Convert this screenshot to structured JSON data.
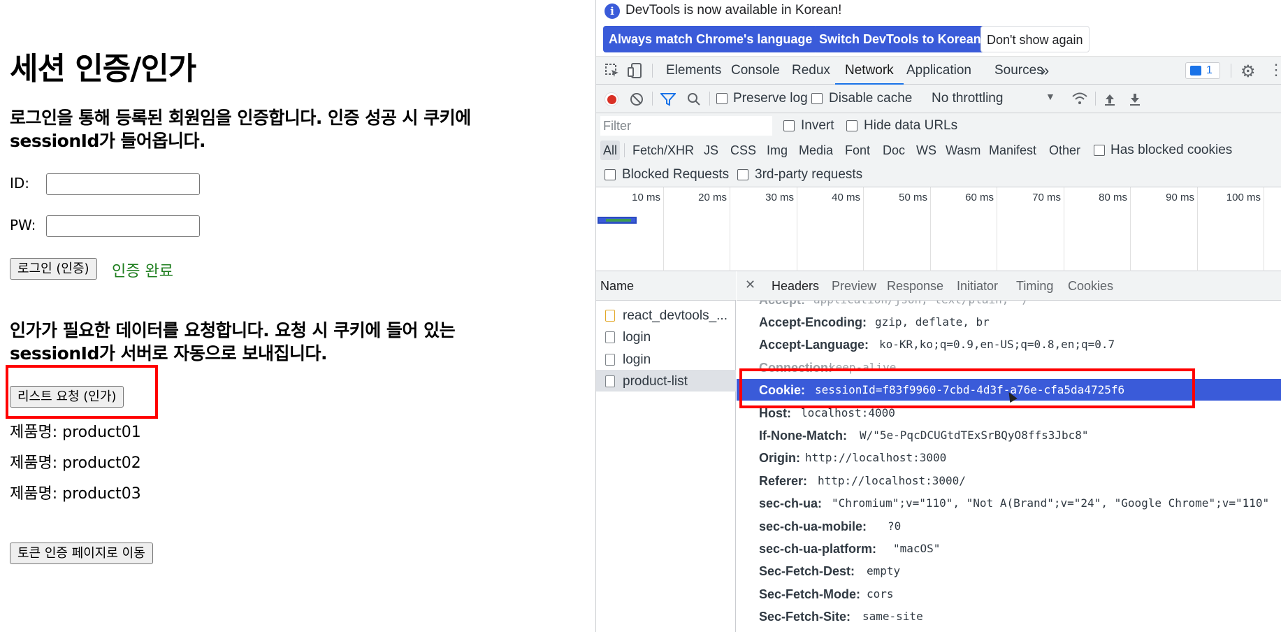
{
  "page": {
    "title": "세션 인증/인가",
    "login_desc_1": "로그인을 통해 등록된 회원임을 인증합니다. 인증 성공 시 쿠키에",
    "login_desc_2": "sessionId가 들어옵니다.",
    "id_label": "ID:",
    "pw_label": "PW:",
    "id_value": "",
    "pw_value": "",
    "login_button": "로그인 (인증)",
    "auth_status": "인증 완료",
    "authz_desc_1": "인가가 필요한 데이터를 요청합니다. 요청 시 쿠키에 들어 있는",
    "authz_desc_2": "sessionId가 서버로 자동으로 보내집니다.",
    "list_button": "리스트 요청 (인가)",
    "products": [
      "제품명: product01",
      "제품명: product02",
      "제품명: product03"
    ],
    "token_button": "토큰 인증 페이지로 이동"
  },
  "devtools": {
    "infobar": {
      "message": "DevTools is now available in Korean!",
      "btn_match": "Always match Chrome's language",
      "btn_switch": "Switch DevTools to Korean",
      "btn_dismiss": "Don't show again"
    },
    "tabs": [
      "Elements",
      "Console",
      "Redux",
      "Network",
      "Application",
      "Sources"
    ],
    "active_tab": "Network",
    "more_tabs": "»",
    "issues_count": "1",
    "toolbar": {
      "preserve_log": "Preserve log",
      "disable_cache": "Disable cache",
      "throttling": "No throttling"
    },
    "filter": {
      "placeholder": "Filter",
      "invert": "Invert",
      "hide_data_urls": "Hide data URLs",
      "types": [
        "All",
        "Fetch/XHR",
        "JS",
        "CSS",
        "Img",
        "Media",
        "Font",
        "Doc",
        "WS",
        "Wasm",
        "Manifest",
        "Other"
      ],
      "has_blocked_cookies": "Has blocked cookies",
      "blocked_requests": "Blocked Requests",
      "third_party": "3rd-party requests"
    },
    "overview_ticks": [
      "10 ms",
      "20 ms",
      "30 ms",
      "40 ms",
      "50 ms",
      "60 ms",
      "70 ms",
      "80 ms",
      "90 ms",
      "100 ms"
    ],
    "name_header": "Name",
    "requests": [
      "react_devtools_...",
      "login",
      "login",
      "product-list"
    ],
    "selected_request": "product-list",
    "detail_tabs": [
      "Headers",
      "Preview",
      "Response",
      "Initiator",
      "Timing",
      "Cookies"
    ],
    "active_detail_tab": "Headers",
    "headers": [
      {
        "k": "Accept:",
        "v": "application/json, text/plain, */*"
      },
      {
        "k": "Accept-Encoding:",
        "v": "gzip, deflate, br"
      },
      {
        "k": "Accept-Language:",
        "v": "ko-KR,ko;q=0.9,en-US;q=0.8,en;q=0.7"
      },
      {
        "k": "Connection:",
        "v": "keep-alive"
      },
      {
        "k": "Cookie:",
        "v": "sessionId=f83f9960-7cbd-4d3f-a76e-cfa5da4725f6"
      },
      {
        "k": "Host:",
        "v": "localhost:4000"
      },
      {
        "k": "If-None-Match:",
        "v": "W/\"5e-PqcDCUGtdTExSrBQyO8ffs3Jbc8\""
      },
      {
        "k": "Origin:",
        "v": "http://localhost:3000"
      },
      {
        "k": "Referer:",
        "v": "http://localhost:3000/"
      },
      {
        "k": "sec-ch-ua:",
        "v": "\"Chromium\";v=\"110\", \"Not A(Brand\";v=\"24\", \"Google Chrome\";v=\"110\""
      },
      {
        "k": "sec-ch-ua-mobile:",
        "v": "?0"
      },
      {
        "k": "sec-ch-ua-platform:",
        "v": "\"macOS\""
      },
      {
        "k": "Sec-Fetch-Dest:",
        "v": "empty"
      },
      {
        "k": "Sec-Fetch-Mode:",
        "v": "cors"
      },
      {
        "k": "Sec-Fetch-Site:",
        "v": "same-site"
      }
    ],
    "colors": {
      "accent": "#3a5bd9",
      "highlight_box": "#ff0000",
      "success": "#1e7e1e"
    }
  }
}
